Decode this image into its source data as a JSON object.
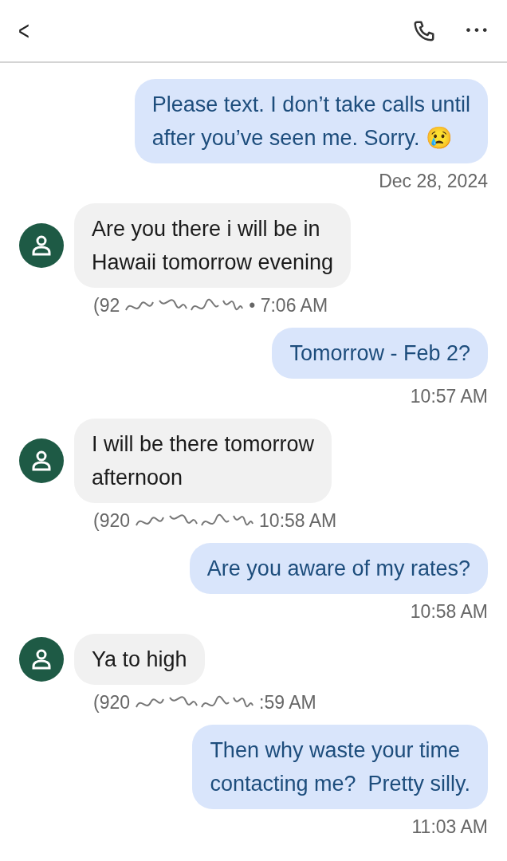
{
  "header": {
    "back": "<",
    "menu": "•••"
  },
  "messages": [
    {
      "kind": "outgoing",
      "text": "Please text. I don’t take calls until\nafter you’ve seen me. Sorry. 😢",
      "time": "Dec 28, 2024"
    },
    {
      "kind": "incoming",
      "text": "Are you there i will be in\nHawaii tomorrow evening",
      "sender": "(92",
      "time": "• 7:06 AM"
    },
    {
      "kind": "outgoing",
      "text": "Tomorrow - Feb 2?",
      "time": "10:57 AM"
    },
    {
      "kind": "incoming",
      "text": "I will be there tomorrow\nafternoon",
      "sender": "(920",
      "time": "10:58 AM"
    },
    {
      "kind": "outgoing",
      "text": "Are you aware of my rates?",
      "time": "10:58 AM"
    },
    {
      "kind": "incoming",
      "text": "Ya to high",
      "sender": "(920",
      "time": ":59 AM"
    },
    {
      "kind": "outgoing",
      "text": "Then why waste your time\ncontacting me?  Pretty silly.",
      "time": "11:03 AM"
    }
  ]
}
